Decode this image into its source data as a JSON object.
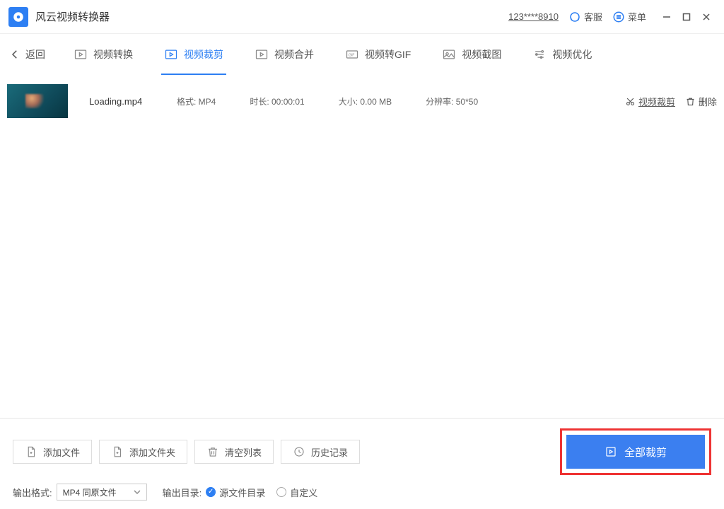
{
  "titlebar": {
    "app_name": "风云视频转换器",
    "user_id": "123****8910",
    "support_label": "客服",
    "menu_label": "菜单"
  },
  "nav": {
    "back_label": "返回",
    "tabs": [
      {
        "label": "视频转换"
      },
      {
        "label": "视频裁剪"
      },
      {
        "label": "视频合并"
      },
      {
        "label": "视频转GIF"
      },
      {
        "label": "视频截图"
      },
      {
        "label": "视频优化"
      }
    ]
  },
  "file": {
    "name": "Loading.mp4",
    "format": "格式: MP4",
    "duration": "时长: 00:00:01",
    "size": "大小: 0.00 MB",
    "resolution": "分辨率: 50*50",
    "crop_action": "视频裁剪",
    "delete_action": "删除"
  },
  "bottom": {
    "add_file": "添加文件",
    "add_folder": "添加文件夹",
    "clear_list": "清空列表",
    "history": "历史记录",
    "primary": "全部裁剪",
    "out_format_label": "输出格式:",
    "out_format_value": "MP4 同原文件",
    "out_dir_label": "输出目录:",
    "radio_source": "源文件目录",
    "radio_custom": "自定义"
  }
}
